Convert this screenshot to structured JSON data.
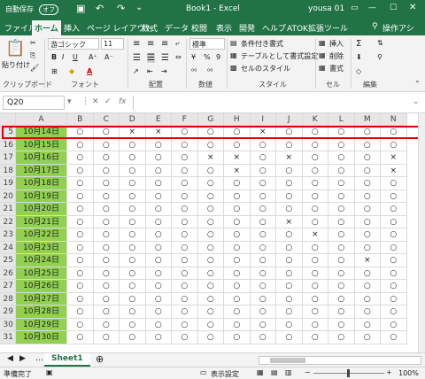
{
  "title_bar": {
    "autosave": "自動保存",
    "autosave_state": "オフ",
    "document_title": "Book1 - Excel",
    "user": "yousa 01"
  },
  "tabs": [
    "ファイル",
    "ホーム",
    "挿入",
    "ページ レイアウト",
    "数式",
    "データ",
    "校閲",
    "表示",
    "開発",
    "ヘルプ",
    "ATOK拡張ツール"
  ],
  "search_label": "操作アシ",
  "ribbon": {
    "paste_label": "貼り付け",
    "font_name": "游ゴシック",
    "font_size": "11",
    "number_format": "標準",
    "conditional_format": "条件付き書式",
    "table_format": "テーブルとして書式設定",
    "cell_styles": "セルのスタイル",
    "insert": "挿入",
    "delete": "削除",
    "format": "書式",
    "groups": {
      "clipboard": "クリップボード",
      "font": "フォント",
      "alignment": "配置",
      "number": "数値",
      "styles": "スタイル",
      "cells": "セル",
      "editing": "編集"
    }
  },
  "formula_bar": {
    "name_box": "Q20",
    "fx": "fx",
    "content": ""
  },
  "grid": {
    "columns": [
      "A",
      "B",
      "C",
      "D",
      "E",
      "F",
      "G",
      "H",
      "I",
      "J",
      "K",
      "L",
      "M",
      "N"
    ],
    "rows": [
      {
        "num": "5",
        "date": "10月14日",
        "marks": [
          "○",
          "○",
          "×",
          "×",
          "○",
          "○",
          "○",
          "×",
          "○",
          "○",
          "○",
          "○",
          "○"
        ]
      },
      {
        "num": "16",
        "date": "10月15日",
        "marks": [
          "○",
          "○",
          "○",
          "○",
          "○",
          "○",
          "○",
          "○",
          "○",
          "○",
          "○",
          "○",
          "○"
        ]
      },
      {
        "num": "17",
        "date": "10月16日",
        "marks": [
          "○",
          "○",
          "○",
          "○",
          "○",
          "×",
          "×",
          "○",
          "×",
          "○",
          "○",
          "○",
          "×"
        ]
      },
      {
        "num": "18",
        "date": "10月17日",
        "marks": [
          "○",
          "○",
          "○",
          "○",
          "○",
          "○",
          "×",
          "○",
          "○",
          "○",
          "○",
          "○",
          "×"
        ]
      },
      {
        "num": "19",
        "date": "10月18日",
        "marks": [
          "○",
          "○",
          "○",
          "○",
          "○",
          "○",
          "○",
          "○",
          "○",
          "○",
          "○",
          "○",
          "○"
        ]
      },
      {
        "num": "20",
        "date": "10月19日",
        "marks": [
          "○",
          "○",
          "○",
          "○",
          "○",
          "○",
          "○",
          "○",
          "○",
          "○",
          "○",
          "○",
          "○"
        ]
      },
      {
        "num": "21",
        "date": "10月20日",
        "marks": [
          "○",
          "○",
          "○",
          "○",
          "○",
          "○",
          "○",
          "○",
          "○",
          "○",
          "○",
          "○",
          "○"
        ]
      },
      {
        "num": "22",
        "date": "10月21日",
        "marks": [
          "○",
          "○",
          "○",
          "○",
          "○",
          "○",
          "○",
          "○",
          "×",
          "○",
          "○",
          "○",
          "○"
        ]
      },
      {
        "num": "23",
        "date": "10月22日",
        "marks": [
          "○",
          "○",
          "○",
          "○",
          "○",
          "○",
          "○",
          "○",
          "○",
          "×",
          "○",
          "○",
          "○"
        ]
      },
      {
        "num": "24",
        "date": "10月23日",
        "marks": [
          "○",
          "○",
          "○",
          "○",
          "○",
          "○",
          "○",
          "○",
          "○",
          "○",
          "○",
          "○",
          "○"
        ]
      },
      {
        "num": "25",
        "date": "10月24日",
        "marks": [
          "○",
          "○",
          "○",
          "○",
          "○",
          "○",
          "○",
          "○",
          "○",
          "○",
          "○",
          "×",
          "○"
        ]
      },
      {
        "num": "26",
        "date": "10月25日",
        "marks": [
          "○",
          "○",
          "○",
          "○",
          "○",
          "○",
          "○",
          "○",
          "○",
          "○",
          "○",
          "○",
          "○"
        ]
      },
      {
        "num": "27",
        "date": "10月26日",
        "marks": [
          "○",
          "○",
          "○",
          "○",
          "○",
          "○",
          "○",
          "○",
          "○",
          "○",
          "○",
          "○",
          "○"
        ]
      },
      {
        "num": "28",
        "date": "10月27日",
        "marks": [
          "○",
          "○",
          "○",
          "○",
          "○",
          "○",
          "○",
          "○",
          "○",
          "○",
          "○",
          "○",
          "○"
        ]
      },
      {
        "num": "29",
        "date": "10月28日",
        "marks": [
          "○",
          "○",
          "○",
          "○",
          "○",
          "○",
          "○",
          "○",
          "○",
          "○",
          "○",
          "○",
          "○"
        ]
      },
      {
        "num": "30",
        "date": "10月29日",
        "marks": [
          "○",
          "○",
          "○",
          "○",
          "○",
          "○",
          "○",
          "○",
          "○",
          "○",
          "○",
          "○",
          "○"
        ]
      },
      {
        "num": "31",
        "date": "10月30日",
        "marks": [
          "○",
          "○",
          "○",
          "○",
          "○",
          "○",
          "○",
          "○",
          "○",
          "○",
          "○",
          "○",
          "○"
        ]
      }
    ]
  },
  "sheet_tab": "Sheet1",
  "status": {
    "ready": "準備完了",
    "display_settings": "表示設定",
    "zoom": "100%"
  },
  "colors": {
    "excel_green": "#217346",
    "date_fill": "#92d050",
    "highlight": "#e00000"
  }
}
